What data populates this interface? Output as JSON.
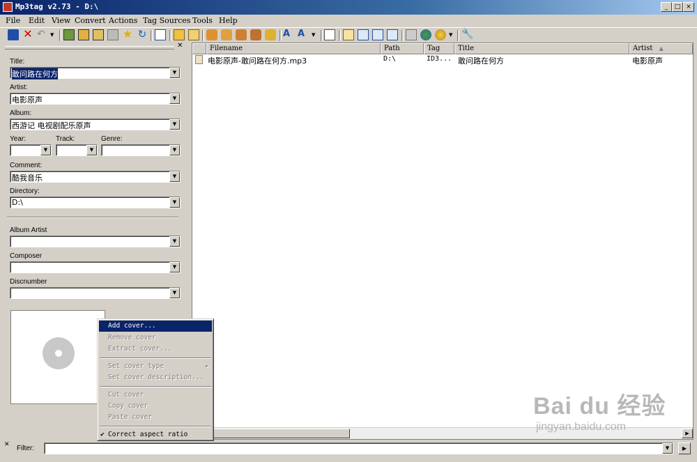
{
  "window": {
    "title": "Mp3tag v2.73  -  D:\\"
  },
  "menu": [
    "File",
    "Edit",
    "View",
    "Convert",
    "Actions",
    "Tag Sources",
    "Tools",
    "Help"
  ],
  "fields": {
    "title_label": "Title:",
    "title_value": "敢问路在何方",
    "artist_label": "Artist:",
    "artist_value": "电影原声",
    "album_label": "Album:",
    "album_value": "西游记 电视剧配乐原声",
    "year_label": "Year:",
    "track_label": "Track:",
    "genre_label": "Genre:",
    "comment_label": "Comment:",
    "comment_value": "酷我音乐",
    "directory_label": "Directory:",
    "directory_value": "D:\\",
    "album_artist_label": "Album Artist",
    "composer_label": "Composer",
    "discnumber_label": "Discnumber"
  },
  "list": {
    "columns": [
      "Filename",
      "Path",
      "Tag",
      "Title",
      "Artist"
    ],
    "rows": [
      {
        "filename": "电影原声-敢问路在何方.mp3",
        "path": "D:\\",
        "tag": "ID3...",
        "title": "敢问路在何方",
        "artist": "电影原声"
      }
    ]
  },
  "context_menu": {
    "add_cover": "Add cover...",
    "remove_cover": "Remove cover",
    "extract_cover": "Extract cover...",
    "set_cover_type": "Set cover type",
    "set_cover_description": "Set cover description...",
    "cut_cover": "Cut cover",
    "copy_cover": "Copy cover",
    "paste_cover": "Paste cover",
    "correct_aspect_ratio": "Correct aspect ratio",
    "check": "✔",
    "submenu_arrow": "▸"
  },
  "filter": {
    "label": "Filter:"
  },
  "watermark": {
    "brand": "Bai du 经验",
    "url": "jingyan.baidu.com"
  },
  "colors": {
    "selection": "#0a246a",
    "face": "#d4d0c8"
  }
}
